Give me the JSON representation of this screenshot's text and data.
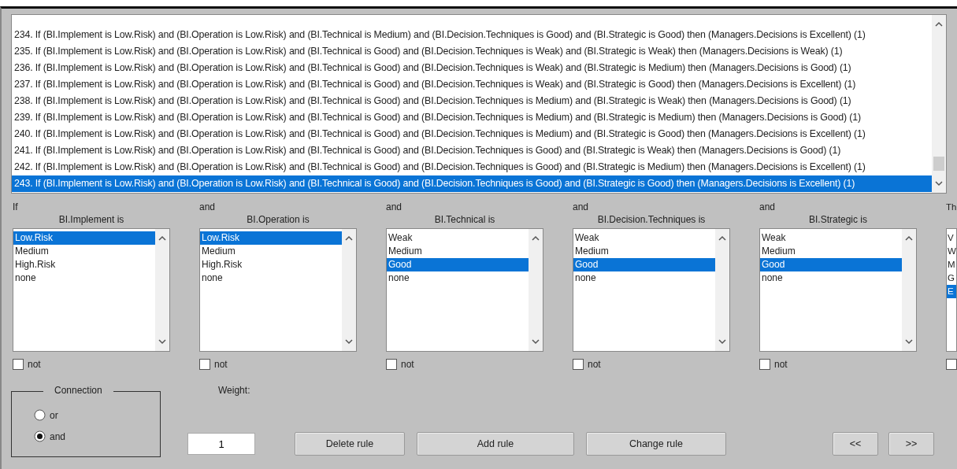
{
  "rules": [
    {
      "text": "234. If (BI.Implement is Low.Risk) and (BI.Operation is Low.Risk) and (BI.Technical is Medium) and (BI.Decision.Techniques is Good) and (BI.Strategic is Good) then (Managers.Decisions is Excellent) (1)",
      "selected": false
    },
    {
      "text": "235. If (BI.Implement is Low.Risk) and (BI.Operation is Low.Risk) and (BI.Technical is Good) and (BI.Decision.Techniques is Weak) and (BI.Strategic is Weak) then (Managers.Decisions is Weak) (1)",
      "selected": false
    },
    {
      "text": "236. If (BI.Implement is Low.Risk) and (BI.Operation is Low.Risk) and (BI.Technical is Good) and (BI.Decision.Techniques is Weak) and (BI.Strategic is Medium) then (Managers.Decisions is Good) (1)",
      "selected": false
    },
    {
      "text": "237. If (BI.Implement is Low.Risk) and (BI.Operation is Low.Risk) and (BI.Technical is Good) and (BI.Decision.Techniques is Weak) and (BI.Strategic is Good) then (Managers.Decisions is Excellent) (1)",
      "selected": false
    },
    {
      "text": "238. If (BI.Implement is Low.Risk) and (BI.Operation is Low.Risk) and (BI.Technical is Good) and (BI.Decision.Techniques is Medium) and (BI.Strategic is Weak) then (Managers.Decisions is Good) (1)",
      "selected": false
    },
    {
      "text": "239. If (BI.Implement is Low.Risk) and (BI.Operation is Low.Risk) and (BI.Technical is Good) and (BI.Decision.Techniques is Medium) and (BI.Strategic is Medium) then (Managers.Decisions is Good) (1)",
      "selected": false
    },
    {
      "text": "240. If (BI.Implement is Low.Risk) and (BI.Operation is Low.Risk) and (BI.Technical is Good) and (BI.Decision.Techniques is Medium) and (BI.Strategic is Good) then (Managers.Decisions is Excellent) (1)",
      "selected": false
    },
    {
      "text": "241. If (BI.Implement is Low.Risk) and (BI.Operation is Low.Risk) and (BI.Technical is Good) and (BI.Decision.Techniques is Good) and (BI.Strategic is Weak) then (Managers.Decisions is Good) (1)",
      "selected": false
    },
    {
      "text": "242. If (BI.Implement is Low.Risk) and (BI.Operation is Low.Risk) and (BI.Technical is Good) and (BI.Decision.Techniques is Good) and (BI.Strategic is Medium) then (Managers.Decisions is Excellent) (1)",
      "selected": false
    },
    {
      "text": "243. If (BI.Implement is Low.Risk) and (BI.Operation is Low.Risk) and (BI.Technical is Good) and (BI.Decision.Techniques is Good) and (BI.Strategic is Good) then (Managers.Decisions is Excellent) (1)",
      "selected": true
    }
  ],
  "columns": [
    {
      "connector": "If",
      "label": "BI.Implement is",
      "not": {
        "label": "not",
        "checked": false
      },
      "options": [
        {
          "label": "Low.Risk",
          "selected": true
        },
        {
          "label": "Medium",
          "selected": false
        },
        {
          "label": "High.Risk",
          "selected": false
        },
        {
          "label": "none",
          "selected": false
        }
      ]
    },
    {
      "connector": "and",
      "label": "BI.Operation is",
      "not": {
        "label": "not",
        "checked": false
      },
      "options": [
        {
          "label": "Low.Risk",
          "selected": true
        },
        {
          "label": "Medium",
          "selected": false
        },
        {
          "label": "High.Risk",
          "selected": false
        },
        {
          "label": "none",
          "selected": false
        }
      ]
    },
    {
      "connector": "and",
      "label": "BI.Technical is",
      "not": {
        "label": "not",
        "checked": false
      },
      "options": [
        {
          "label": "Weak",
          "selected": false
        },
        {
          "label": "Medium",
          "selected": false
        },
        {
          "label": "Good",
          "selected": true
        },
        {
          "label": "none",
          "selected": false
        }
      ]
    },
    {
      "connector": "and",
      "label": "BI.Decision.Techniques is",
      "not": {
        "label": "not",
        "checked": false
      },
      "options": [
        {
          "label": "Weak",
          "selected": false
        },
        {
          "label": "Medium",
          "selected": false
        },
        {
          "label": "Good",
          "selected": true
        },
        {
          "label": "none",
          "selected": false
        }
      ]
    },
    {
      "connector": "and",
      "label": "BI.Strategic is",
      "not": {
        "label": "not",
        "checked": false
      },
      "options": [
        {
          "label": "Weak",
          "selected": false
        },
        {
          "label": "Medium",
          "selected": false
        },
        {
          "label": "Good",
          "selected": true
        },
        {
          "label": "none",
          "selected": false
        }
      ]
    }
  ],
  "partial_column": {
    "connector": "Th",
    "not": {
      "checked": false
    },
    "options": [
      {
        "label": "V",
        "selected": false
      },
      {
        "label": "W",
        "selected": false
      },
      {
        "label": "M",
        "selected": false
      },
      {
        "label": "G",
        "selected": false
      },
      {
        "label": "E",
        "selected": true
      }
    ]
  },
  "connection": {
    "title": "Connection",
    "options": [
      {
        "label": "or",
        "selected": false
      },
      {
        "label": "and",
        "selected": true
      }
    ]
  },
  "weight": {
    "label": "Weight:",
    "value": "1"
  },
  "buttons": [
    "Delete rule",
    "Add rule",
    "Change rule",
    "<<",
    ">>"
  ]
}
